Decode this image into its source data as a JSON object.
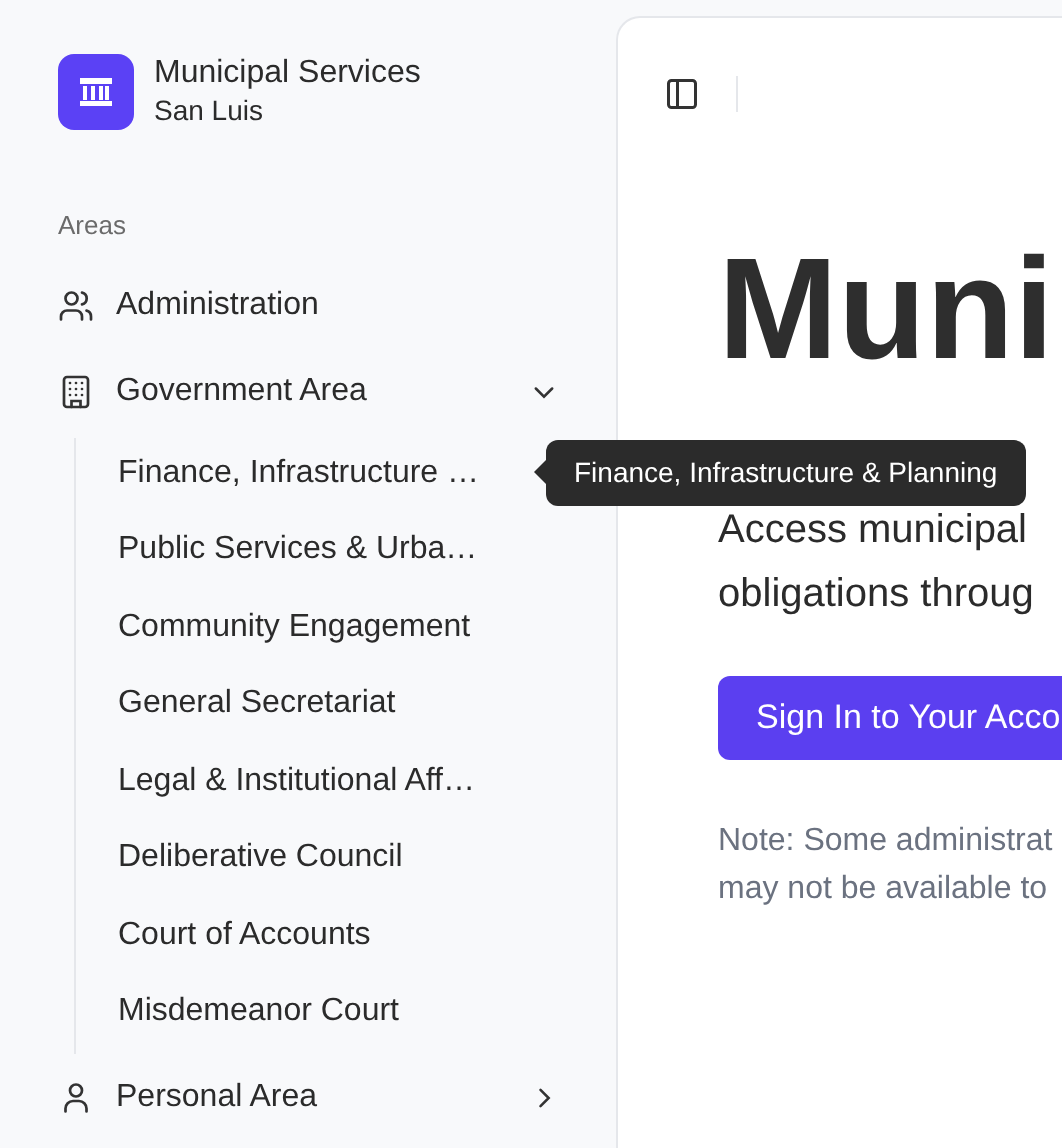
{
  "brand": {
    "title": "Municipal Services",
    "subtitle": "San Luis"
  },
  "sidebar": {
    "section_label": "Areas",
    "items": [
      {
        "label": "Administration",
        "kind": "link"
      },
      {
        "label": "Government Area",
        "kind": "group",
        "expanded": true,
        "children": [
          {
            "label": "Finance, Infrastructure …"
          },
          {
            "label": "Public Services & Urba…"
          },
          {
            "label": "Community Engagement"
          },
          {
            "label": "General Secretariat"
          },
          {
            "label": "Legal & Institutional Aff…"
          },
          {
            "label": "Deliberative Council"
          },
          {
            "label": "Court of Accounts"
          },
          {
            "label": "Misdemeanor Court"
          }
        ]
      },
      {
        "label": "Personal Area",
        "kind": "group",
        "expanded": false
      }
    ]
  },
  "tooltip": {
    "text": "Finance, Infrastructure & Planning"
  },
  "main": {
    "heading": "Muni",
    "description_lines": [
      "Access municipal",
      "obligations throug"
    ],
    "sign_in_button": "Sign In to Your Acco",
    "note_lines": [
      "Note: Some administrat",
      "may not be available to"
    ]
  }
}
